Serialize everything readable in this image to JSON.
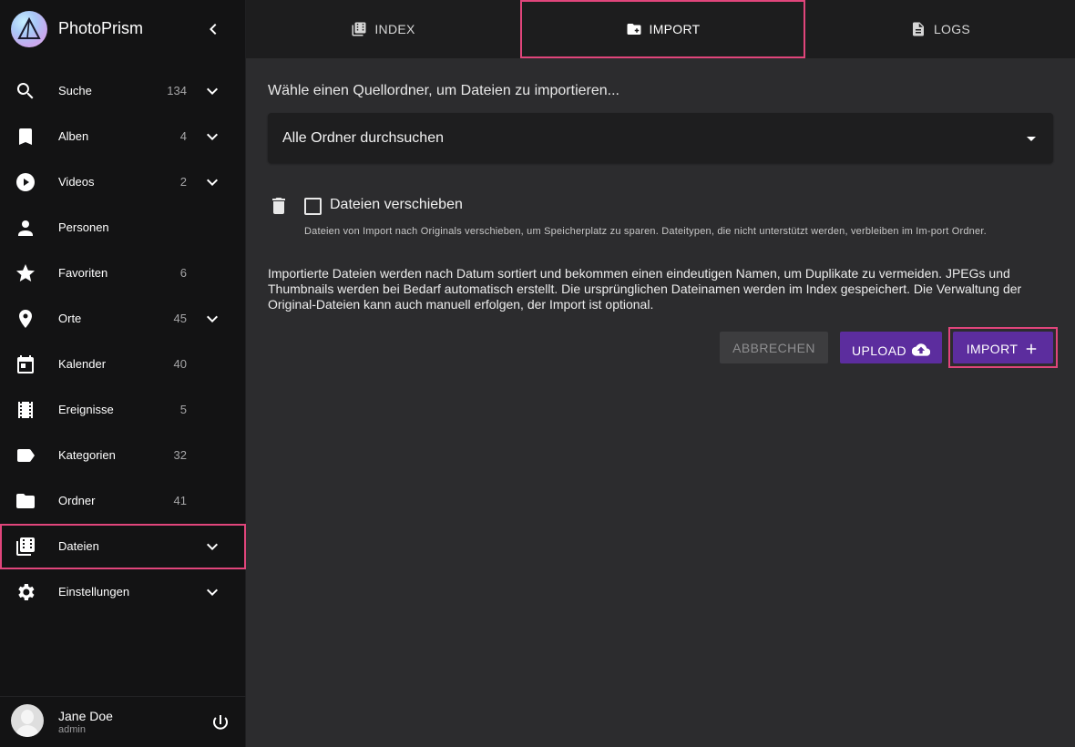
{
  "app": {
    "name": "PhotoPrism"
  },
  "sidebar": {
    "items": [
      {
        "label": "Suche",
        "count": "134",
        "icon": "search-icon",
        "expandable": true
      },
      {
        "label": "Alben",
        "count": "4",
        "icon": "bookmark-icon",
        "expandable": true
      },
      {
        "label": "Videos",
        "count": "2",
        "icon": "play-circle-icon",
        "expandable": true
      },
      {
        "label": "Personen",
        "count": "",
        "icon": "person-icon",
        "expandable": false
      },
      {
        "label": "Favoriten",
        "count": "6",
        "icon": "star-icon",
        "expandable": false
      },
      {
        "label": "Orte",
        "count": "45",
        "icon": "place-icon",
        "expandable": true
      },
      {
        "label": "Kalender",
        "count": "40",
        "icon": "calendar-icon",
        "expandable": false
      },
      {
        "label": "Ereignisse",
        "count": "5",
        "icon": "film-icon",
        "expandable": false
      },
      {
        "label": "Kategorien",
        "count": "32",
        "icon": "label-icon",
        "expandable": false
      },
      {
        "label": "Ordner",
        "count": "41",
        "icon": "folder-icon",
        "expandable": false
      },
      {
        "label": "Dateien",
        "count": "",
        "icon": "file-library-icon",
        "expandable": true,
        "active": true
      },
      {
        "label": "Einstellungen",
        "count": "",
        "icon": "gear-icon",
        "expandable": true
      }
    ]
  },
  "user": {
    "name": "Jane Doe",
    "role": "admin"
  },
  "tabs": [
    {
      "label": "INDEX",
      "icon": "folder-film-icon"
    },
    {
      "label": "IMPORT",
      "icon": "folder-add-icon",
      "active": true
    },
    {
      "label": "LOGS",
      "icon": "document-icon"
    }
  ],
  "import": {
    "subheading": "Wähle einen Quellordner, um Dateien zu importieren...",
    "source_select": "Alle Ordner durchsuchen",
    "move_files_label": "Dateien verschieben",
    "move_files_hint": "Dateien von Import nach Originals verschieben, um Speicherplatz zu sparen. Dateitypen, die nicht unterstützt werden, verbleiben im Im-port Ordner.",
    "info": "Importierte Dateien werden nach Datum sortiert und bekommen einen eindeutigen Namen, um Duplikate zu vermeiden. JPEGs und Thumbnails werden bei Bedarf automatisch erstellt. Die ursprünglichen Dateinamen werden im Index gespeichert. Die Verwaltung der Original-Dateien kann auch manuell erfolgen, der Import ist optional.",
    "cancel_label": "ABBRECHEN",
    "upload_label": "UPLOAD",
    "import_label": "IMPORT"
  },
  "colors": {
    "accent": "#5c2d9e",
    "highlight": "#e0457b",
    "sidebar_bg": "#131314",
    "content_bg": "#2c2c2e"
  }
}
